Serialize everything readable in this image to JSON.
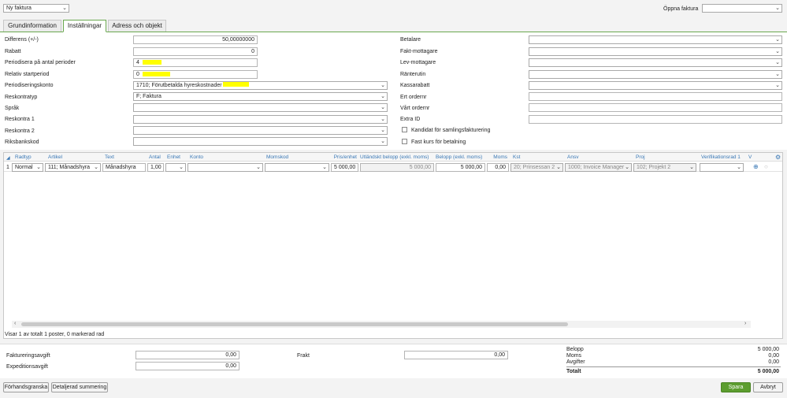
{
  "toolbar": {
    "mode_select": "Ny faktura",
    "open_invoice_label": "Öppna faktura",
    "open_invoice_value": ""
  },
  "tabs": [
    {
      "label": "Grundinformation"
    },
    {
      "label": "Inställningar"
    },
    {
      "label": "Adress och objekt"
    }
  ],
  "left_fields": [
    {
      "label": "Differens (+/-)",
      "value": "50,00000000"
    },
    {
      "label": "Rabatt",
      "value": "0"
    },
    {
      "label": "Periodisera på antal perioder",
      "value": "4"
    },
    {
      "label": "Relativ startperiod",
      "value": "0"
    },
    {
      "label": "Periodiseringskonto",
      "value": "1710; Förutbetalda hyreskostnader"
    },
    {
      "label": "Reskontratyp",
      "value": "F; Faktura"
    },
    {
      "label": "Språk",
      "value": ""
    },
    {
      "label": "Reskontra 1",
      "value": ""
    },
    {
      "label": "Reskontra 2",
      "value": ""
    },
    {
      "label": "Riksbankskod",
      "value": ""
    }
  ],
  "right_fields": [
    {
      "label": "Betalare",
      "value": ""
    },
    {
      "label": "Fakt-mottagare",
      "value": ""
    },
    {
      "label": "Lev-mottagare",
      "value": ""
    },
    {
      "label": "Ränterutin",
      "value": ""
    },
    {
      "label": "Kassarabatt",
      "value": ""
    },
    {
      "label": "Ert ordernr",
      "value": ""
    },
    {
      "label": "Vårt ordernr",
      "value": ""
    },
    {
      "label": "Extra ID",
      "value": ""
    }
  ],
  "checkboxes": [
    {
      "label": "Kandidat för samlingsfakturering",
      "checked": false
    },
    {
      "label": "Fast kurs för betalning",
      "checked": false
    }
  ],
  "grid": {
    "headers": [
      "Radtyp",
      "Artikel",
      "Text",
      "Antal",
      "Enhet",
      "Konto",
      "Momskod",
      "Pris/enhet",
      "Utländskt belopp (exkl. moms)",
      "Belopp (exkl. moms)",
      "Moms",
      "Kst",
      "Ansv",
      "Proj",
      "Verifikationsrad 1",
      "V"
    ],
    "row": {
      "num": "1",
      "radtyp": "Normal",
      "artikel": "111; Månadshyra",
      "text": "Månadshyra",
      "antal": "1,00",
      "enhet": "",
      "konto": "",
      "momskod": "",
      "pris": "5 000,00",
      "utl_belopp": "5 000,00",
      "belopp": "5 000,00",
      "moms": "0,00",
      "kst": "20; Prinsessan 2",
      "ansv": "1000; Invoice Manager",
      "proj": "102; Projekt 2",
      "verrad": ""
    },
    "status": "Visar 1 av totalt 1 poster, 0 markerad rad"
  },
  "fees": {
    "fakturering_label": "Faktureringsavgift",
    "fakturering_value": "0,00",
    "expedition_label": "Expeditionsavgift",
    "expedition_value": "0,00",
    "frakt_label": "Frakt",
    "frakt_value": "0,00"
  },
  "summary": {
    "belopp_label": "Belopp",
    "belopp_value": "5 000,00",
    "moms_label": "Moms",
    "moms_value": "0,00",
    "avgifter_label": "Avgifter",
    "avgifter_value": "0,00",
    "totalt_label": "Totalt",
    "totalt_value": "5 000,00"
  },
  "buttons": {
    "preview": "Förhandsgranska",
    "detailed_sum": "Detaljerad summering",
    "save": "Spara",
    "cancel": "Avbryt"
  },
  "colors": {
    "accent_green": "#5c9d2f",
    "highlight": "#ffff00",
    "header_blue": "#3a78b5"
  }
}
